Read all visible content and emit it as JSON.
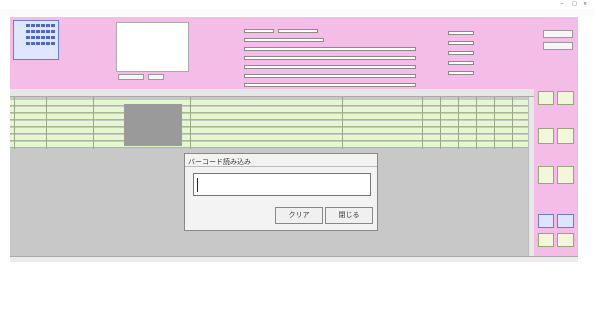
{
  "dialog": {
    "title": "バーコード読み込み",
    "clear_label": "クリア",
    "close_label": "閉じる"
  }
}
